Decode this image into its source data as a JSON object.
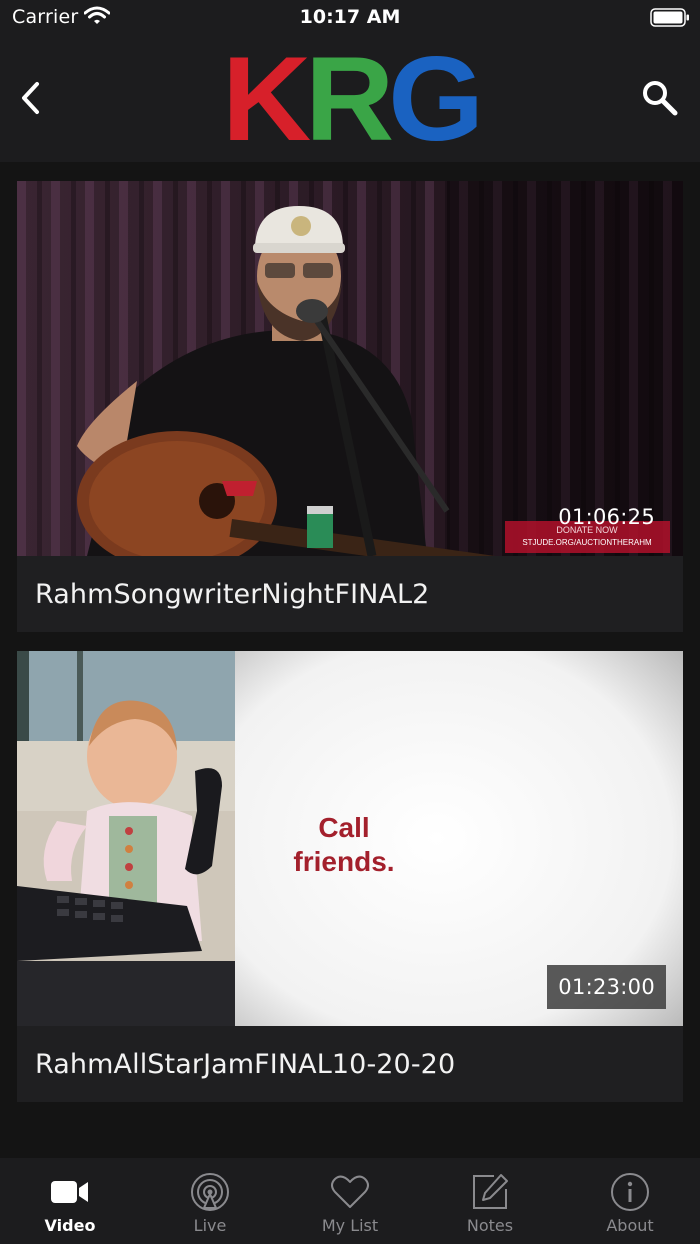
{
  "status_bar": {
    "carrier": "Carrier",
    "time": "10:17 AM"
  },
  "header": {
    "logo_letters": [
      "K",
      "R",
      "G"
    ],
    "logo_colors": [
      "#d7202a",
      "#3aa547",
      "#1a62c1"
    ]
  },
  "videos": [
    {
      "title": "RahmSongwriterNightFINAL2",
      "duration": "01:06:25",
      "overlay_text_1": "DONATE NOW",
      "overlay_text_2": "STJUDE.ORG/AUCTIONTHERAHM"
    },
    {
      "title": "RahmAllStarJamFINAL10-20-20",
      "duration": "01:23:00",
      "slide_line_1": "Call",
      "slide_line_2": "friends."
    }
  ],
  "tabs": [
    {
      "label": "Video",
      "icon": "video-camera-icon",
      "active": true
    },
    {
      "label": "Live",
      "icon": "live-broadcast-icon",
      "active": false
    },
    {
      "label": "My List",
      "icon": "heart-icon",
      "active": false
    },
    {
      "label": "Notes",
      "icon": "notes-edit-icon",
      "active": false
    },
    {
      "label": "About",
      "icon": "info-icon",
      "active": false
    }
  ],
  "colors": {
    "background": "#141414",
    "bar": "#1c1c1e",
    "card": "#1f1f21",
    "slide_text": "#a3202c"
  }
}
